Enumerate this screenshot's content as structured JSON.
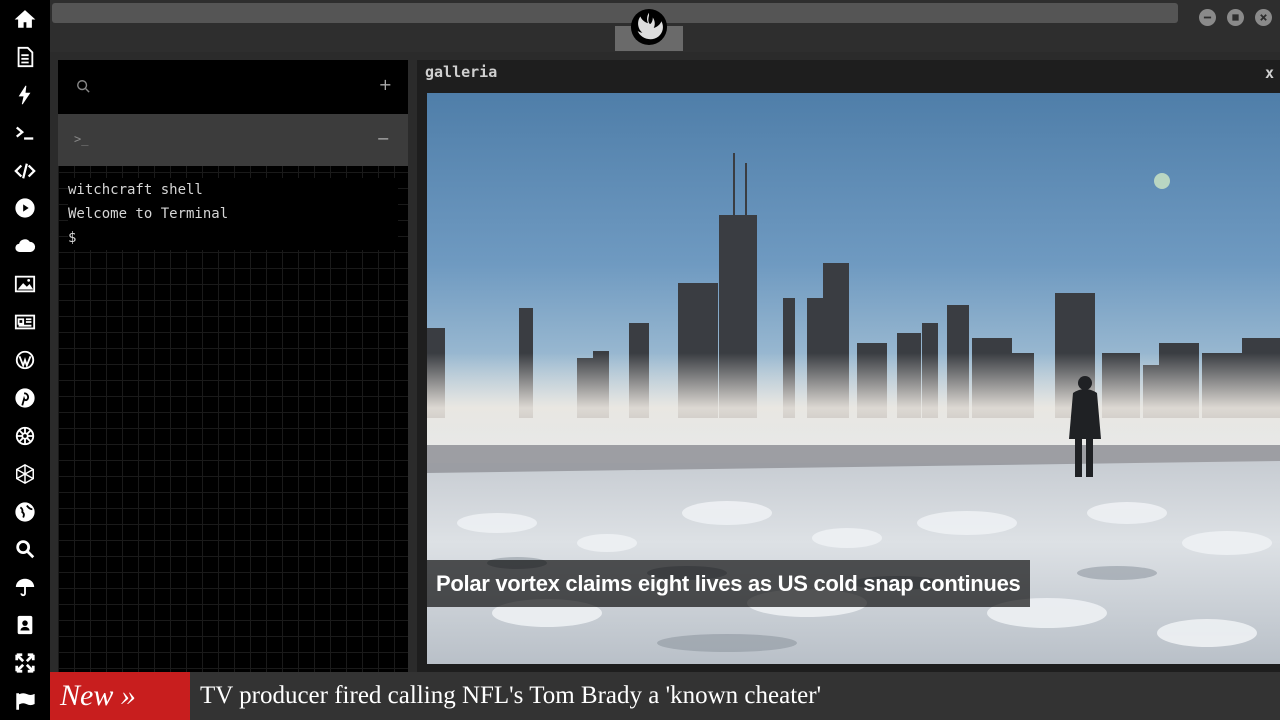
{
  "dock": {
    "items": [
      {
        "name": "home-icon"
      },
      {
        "name": "document-icon"
      },
      {
        "name": "lightning-icon"
      },
      {
        "name": "terminal-icon"
      },
      {
        "name": "code-icon"
      },
      {
        "name": "play-icon"
      },
      {
        "name": "cloud-icon"
      },
      {
        "name": "image-icon"
      },
      {
        "name": "newspaper-icon"
      },
      {
        "name": "wordpress-icon"
      },
      {
        "name": "pinterest-icon"
      },
      {
        "name": "empire-icon"
      },
      {
        "name": "network-icon"
      },
      {
        "name": "globe-icon"
      },
      {
        "name": "search-icon"
      },
      {
        "name": "umbrella-icon"
      },
      {
        "name": "contacts-icon"
      },
      {
        "name": "expand-icon"
      },
      {
        "name": "flag-icon"
      }
    ]
  },
  "topbar": {
    "logo_icon": "rebel-alliance-icon",
    "window_buttons": [
      "minimize-icon",
      "maximize-icon",
      "close-icon"
    ]
  },
  "terminal": {
    "search_icon": "search-icon",
    "add_label": "+",
    "tab_prompt": ">_",
    "collapse_label": "−",
    "lines": [
      "witchcraft shell",
      "Welcome to Terminal",
      "$"
    ]
  },
  "gallery": {
    "title": "galleria",
    "close_label": "x",
    "caption": "Polar vortex claims eight lives as US cold snap continues"
  },
  "ticker": {
    "badge": "New »",
    "headline": "TV producer fired calling NFL's Tom Brady a 'known cheater'"
  },
  "colors": {
    "dock_bg": "#000000",
    "ticker_badge": "#c81e1e",
    "panel_bg": "#1e1e1e"
  }
}
